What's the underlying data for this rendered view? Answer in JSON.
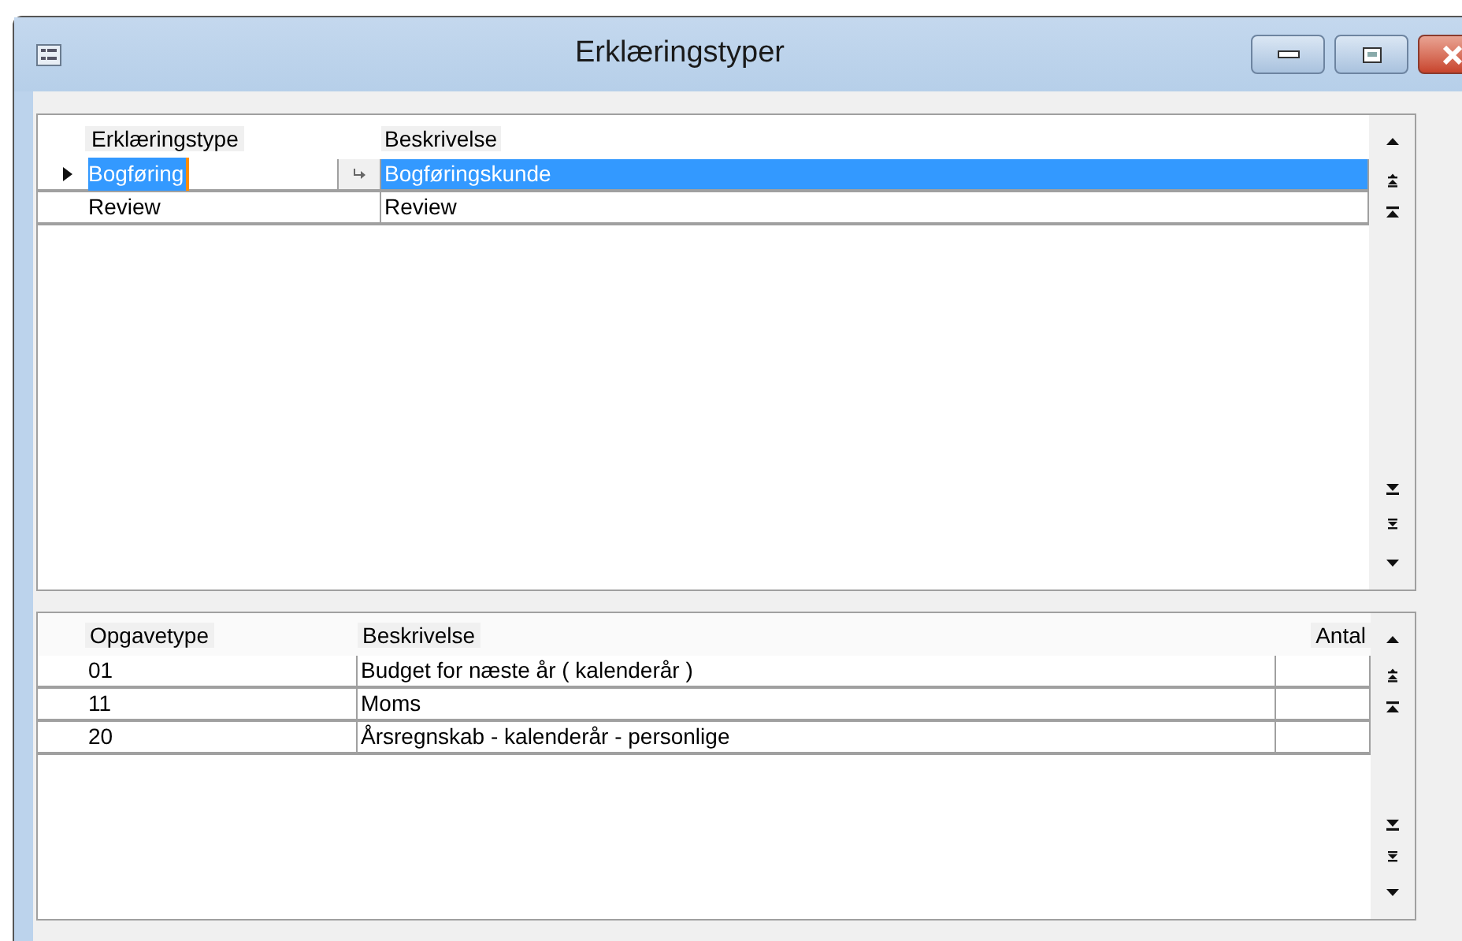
{
  "window": {
    "title": "Erklæringstyper"
  },
  "top_grid": {
    "columns": [
      "Erklæringstype",
      "Beskrivelse"
    ],
    "rows": [
      {
        "cells": [
          "Bogføring",
          "Bogføringskunde"
        ],
        "selected": true
      },
      {
        "cells": [
          "Review",
          "Review"
        ],
        "selected": false
      }
    ]
  },
  "bottom_grid": {
    "columns": [
      "Opgavetype",
      "Beskrivelse",
      "Antal"
    ],
    "rows": [
      {
        "cells": [
          "01",
          "Budget for næste år ( kalenderår )",
          ""
        ],
        "selected": false
      },
      {
        "cells": [
          "11",
          "Moms",
          ""
        ],
        "selected": false
      },
      {
        "cells": [
          "20",
          "Årsregnskab - kalenderår - personlige",
          ""
        ],
        "selected": false
      }
    ]
  }
}
